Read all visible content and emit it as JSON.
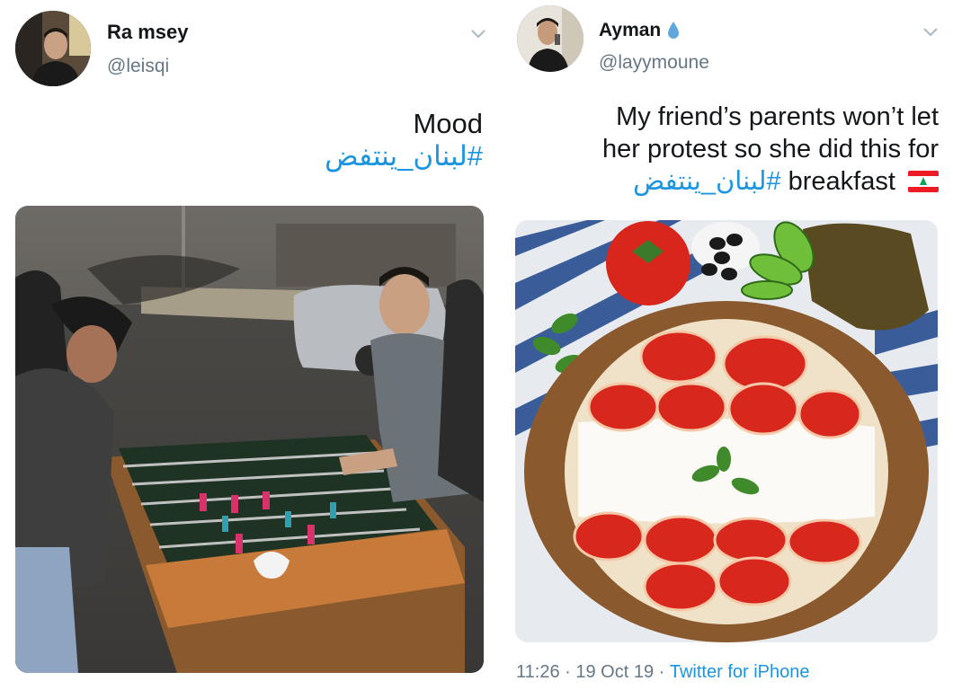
{
  "tweets": [
    {
      "display_name": "Ra msey",
      "handle": "@leisqi",
      "text_line1": "Mood",
      "hashtag": "#لبنان_ينتفض",
      "media_icon": "foosball-photo",
      "avatar_icon": "user-avatar"
    },
    {
      "display_name": "Ayman",
      "verified_icon": "water-drop-icon",
      "handle": "@layymoune",
      "text_line1": "My friend’s parents won’t let",
      "text_line2": "her protest so she did this for",
      "text_line3_word": "breakfast",
      "hashtag": "#لبنان_ينتفض",
      "flag_icon": "lebanon-flag-emoji",
      "media_icon": "breakfast-photo",
      "meta": {
        "time": "11:26",
        "sep1": " · ",
        "date": "19 Oct 19",
        "sep2": " · ",
        "source": "Twitter for iPhone"
      }
    }
  ],
  "colors": {
    "text": "#14171a",
    "secondary": "#657786",
    "link": "#1b95e0"
  }
}
